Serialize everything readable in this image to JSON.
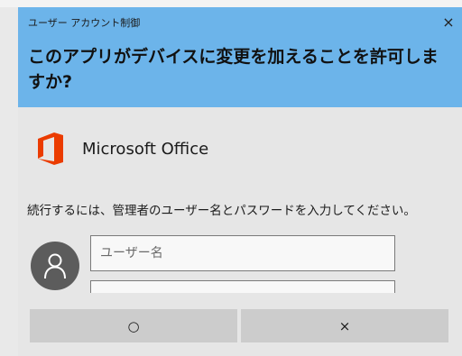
{
  "header": {
    "uac_label": "ユーザー アカウント制御",
    "question": "このアプリがデバイスに変更を加えることを許可しますか?",
    "close_symbol": "×"
  },
  "app": {
    "name": "Microsoft Office",
    "icon": "office-logo-icon",
    "icon_color": "#eb3c00"
  },
  "credentials": {
    "instruction": "続行するには、管理者のユーザー名とパスワードを入力してください。",
    "username_placeholder": "ユーザー名",
    "avatar_icon": "user-avatar-icon"
  },
  "buttons": {
    "yes_label": "○",
    "no_label": "×"
  },
  "colors": {
    "header_bg": "#6cb4ea",
    "dialog_bg": "#e6e6e6",
    "button_bg": "#cccccc"
  }
}
